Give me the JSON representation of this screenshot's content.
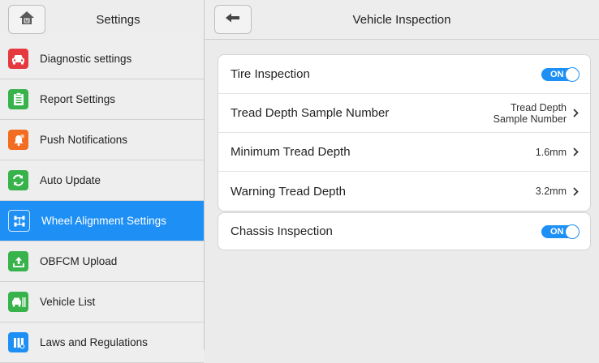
{
  "sidebar": {
    "title": "Settings",
    "items": [
      {
        "label": "Diagnostic settings",
        "icon": "car-icon",
        "color": "#e5393f"
      },
      {
        "label": "Report Settings",
        "icon": "clipboard-icon",
        "color": "#38b24a"
      },
      {
        "label": "Push Notifications",
        "icon": "bell-icon",
        "color": "#f26c22"
      },
      {
        "label": "Auto Update",
        "icon": "sync-icon",
        "color": "#38b24a"
      },
      {
        "label": "Wheel Alignment Settings",
        "icon": "wheel-alignment-icon",
        "color": "#1e90f5",
        "active": true
      },
      {
        "label": "OBFCM Upload",
        "icon": "upload-icon",
        "color": "#38b24a"
      },
      {
        "label": "Vehicle List",
        "icon": "vehicle-list-icon",
        "color": "#38b24a"
      },
      {
        "label": "Laws and Regulations",
        "icon": "book-icon",
        "color": "#1e90f5"
      }
    ]
  },
  "header": {
    "title": "Vehicle Inspection",
    "home_icon": "home-icon",
    "home_badge": "M",
    "back_icon": "back-arrow-icon"
  },
  "tire_card": {
    "tire_inspection": {
      "label": "Tire Inspection",
      "toggle": "ON"
    },
    "tread_sample": {
      "label": "Tread Depth Sample Number",
      "value": "Tread Depth Sample Number"
    },
    "min_tread": {
      "label": "Minimum Tread Depth",
      "value": "1.6mm"
    },
    "warn_tread": {
      "label": "Warning Tread Depth",
      "value": "3.2mm"
    }
  },
  "chassis_card": {
    "chassis_inspection": {
      "label": "Chassis Inspection",
      "toggle": "ON"
    }
  },
  "colors": {
    "accent": "#1e90f5",
    "green": "#38b24a",
    "red": "#e5393f",
    "orange": "#f26c22"
  }
}
